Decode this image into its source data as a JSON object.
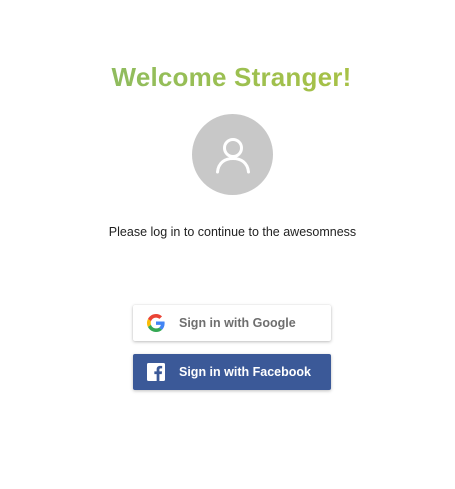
{
  "welcome": {
    "title": "Welcome Stranger!",
    "subtitle": "Please log in to continue to the awesomness",
    "avatar_icon": "user-icon"
  },
  "auth": {
    "google_label": "Sign in with Google",
    "google_icon": "google-icon",
    "facebook_label": "Sign in with Facebook",
    "facebook_icon": "facebook-icon"
  },
  "colors": {
    "title_gradient_start": "#84b96a",
    "title_gradient_end": "#b2c23b",
    "avatar_bg": "#c8c8c8",
    "facebook_bg": "#3b5998",
    "google_text": "#6e6e6e"
  }
}
